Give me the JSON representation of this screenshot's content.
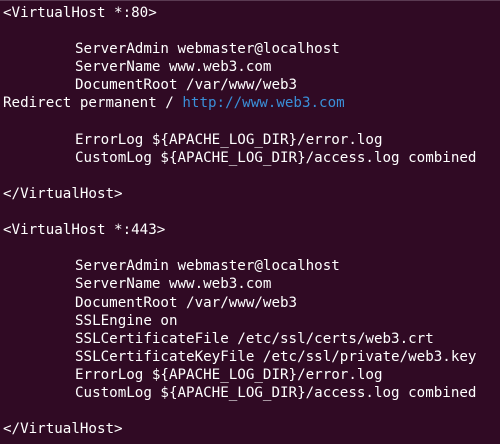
{
  "terminal": {
    "background": "#300a24",
    "text_color": "#ffffff",
    "link_color": "#3a8fd8",
    "lines": [
      {
        "indent": false,
        "text": "<VirtualHost *:80>"
      },
      {
        "indent": false,
        "text": ""
      },
      {
        "indent": true,
        "text": "ServerAdmin webmaster@localhost"
      },
      {
        "indent": true,
        "text": "ServerName www.web3.com"
      },
      {
        "indent": true,
        "text": "DocumentRoot /var/www/web3"
      },
      {
        "indent": false,
        "text": "Redirect permanent / ",
        "link": "http://www.web3.com"
      },
      {
        "indent": false,
        "text": ""
      },
      {
        "indent": true,
        "text": "ErrorLog ${APACHE_LOG_DIR}/error.log"
      },
      {
        "indent": true,
        "text": "CustomLog ${APACHE_LOG_DIR}/access.log combined"
      },
      {
        "indent": false,
        "text": ""
      },
      {
        "indent": false,
        "text": "</VirtualHost>"
      },
      {
        "indent": false,
        "text": ""
      },
      {
        "indent": false,
        "text": "<VirtualHost *:443>"
      },
      {
        "indent": false,
        "text": ""
      },
      {
        "indent": true,
        "text": "ServerAdmin webmaster@localhost"
      },
      {
        "indent": true,
        "text": "ServerName www.web3.com"
      },
      {
        "indent": true,
        "text": "DocumentRoot /var/www/web3"
      },
      {
        "indent": true,
        "text": "SSLEngine on"
      },
      {
        "indent": true,
        "text": "SSLCertificateFile /etc/ssl/certs/web3.crt"
      },
      {
        "indent": true,
        "text": "SSLCertificateKeyFile /etc/ssl/private/web3.key"
      },
      {
        "indent": true,
        "text": "ErrorLog ${APACHE_LOG_DIR}/error.log"
      },
      {
        "indent": true,
        "text": "CustomLog ${APACHE_LOG_DIR}/access.log combined"
      },
      {
        "indent": false,
        "text": ""
      },
      {
        "indent": false,
        "text": "</VirtualHost>"
      }
    ]
  }
}
